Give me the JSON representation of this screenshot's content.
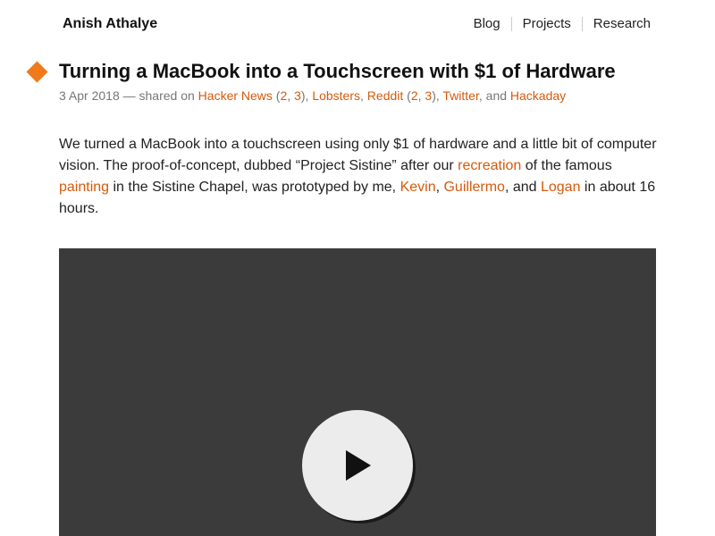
{
  "header": {
    "site_title": "Anish Athalye",
    "nav": [
      {
        "label": "Blog"
      },
      {
        "label": "Projects"
      },
      {
        "label": "Research"
      }
    ]
  },
  "post": {
    "title": "Turning a MacBook into a Touchscreen with $1 of Hardware",
    "marker_icon": "orange-diamond-icon",
    "meta": {
      "date": "3 Apr 2018",
      "shared_text": " — shared on ",
      "hacker_news": "Hacker News",
      "hn_2": "2",
      "hn_3": "3",
      "lobsters": "Lobsters",
      "reddit": "Reddit",
      "reddit_2": "2",
      "reddit_3": "3",
      "twitter": "Twitter",
      "and_text": ", and ",
      "hackaday": "Hackaday"
    },
    "intro": {
      "part1": "We turned a MacBook into a touchscreen using only $1 of hardware and a little bit of computer vision. The proof-of-concept, dubbed “Project Sistine” after our ",
      "recreation": "recreation",
      "part2": " of the famous ",
      "painting": "painting",
      "part3": " in the Sistine Chapel, was prototyped by me, ",
      "kevin": "Kevin",
      "comma": ", ",
      "guillermo": "Guillermo",
      "and": ", and ",
      "logan": "Logan",
      "part4": " in about 16 hours."
    }
  },
  "video": {
    "play_icon": "play-icon"
  },
  "colors": {
    "accent": "#d55a0b",
    "marker": "#f07a1a",
    "video_bg": "#3b3b3b"
  }
}
